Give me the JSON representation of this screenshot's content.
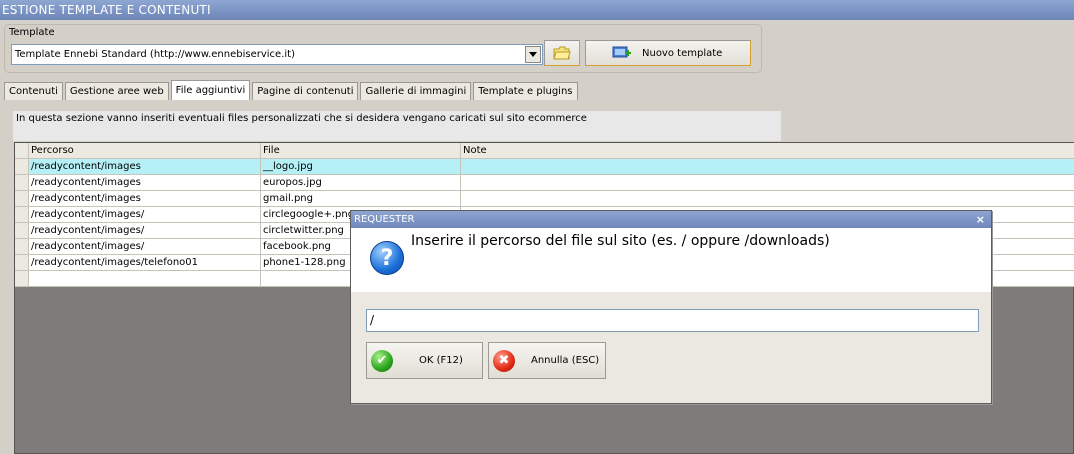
{
  "window": {
    "title": "ESTIONE TEMPLATE E CONTENUTI"
  },
  "template": {
    "group_label": "Template",
    "selected": "Template Ennebi Standard (http://www.ennebiservice.it)",
    "new_button_label": "Nuovo template"
  },
  "tabs": [
    {
      "label": "Contenuti"
    },
    {
      "label": "Gestione aree web"
    },
    {
      "label": "File aggiuntivi"
    },
    {
      "label": "Pagine di contenuti"
    },
    {
      "label": "Gallerie di immagini"
    },
    {
      "label": "Template e plugins"
    }
  ],
  "active_tab": "File aggiuntivi",
  "info_text": "In questa sezione vanno inseriti eventuali files personalizzati che si desidera vengano caricati sul sito ecommerce",
  "grid": {
    "columns": [
      "Percorso",
      "File",
      "Note"
    ],
    "rows": [
      {
        "percorso": "/readycontent/images",
        "file": "__logo.jpg",
        "note": ""
      },
      {
        "percorso": "/readycontent/images",
        "file": "europos.jpg",
        "note": ""
      },
      {
        "percorso": "/readycontent/images",
        "file": "gmail.png",
        "note": ""
      },
      {
        "percorso": "/readycontent/images/",
        "file": "circlegoogle+.png",
        "note": ""
      },
      {
        "percorso": "/readycontent/images/",
        "file": "circletwitter.png",
        "note": ""
      },
      {
        "percorso": "/readycontent/images/",
        "file": "facebook.png",
        "note": ""
      },
      {
        "percorso": "/readycontent/images/telefono01",
        "file": "phone1-128.png",
        "note": ""
      }
    ],
    "selected_row": 0
  },
  "dialog": {
    "title": "REQUESTER",
    "message": "Inserire il percorso del file sul sito (es. / oppure /downloads)",
    "input_value": "/",
    "ok_label": "OK (F12)",
    "cancel_label": "Annulla (ESC)"
  },
  "colors": {
    "titlebar": "#7890c2",
    "selected_row": "#b4f0f6",
    "grid_background": "#7d7c7a"
  }
}
